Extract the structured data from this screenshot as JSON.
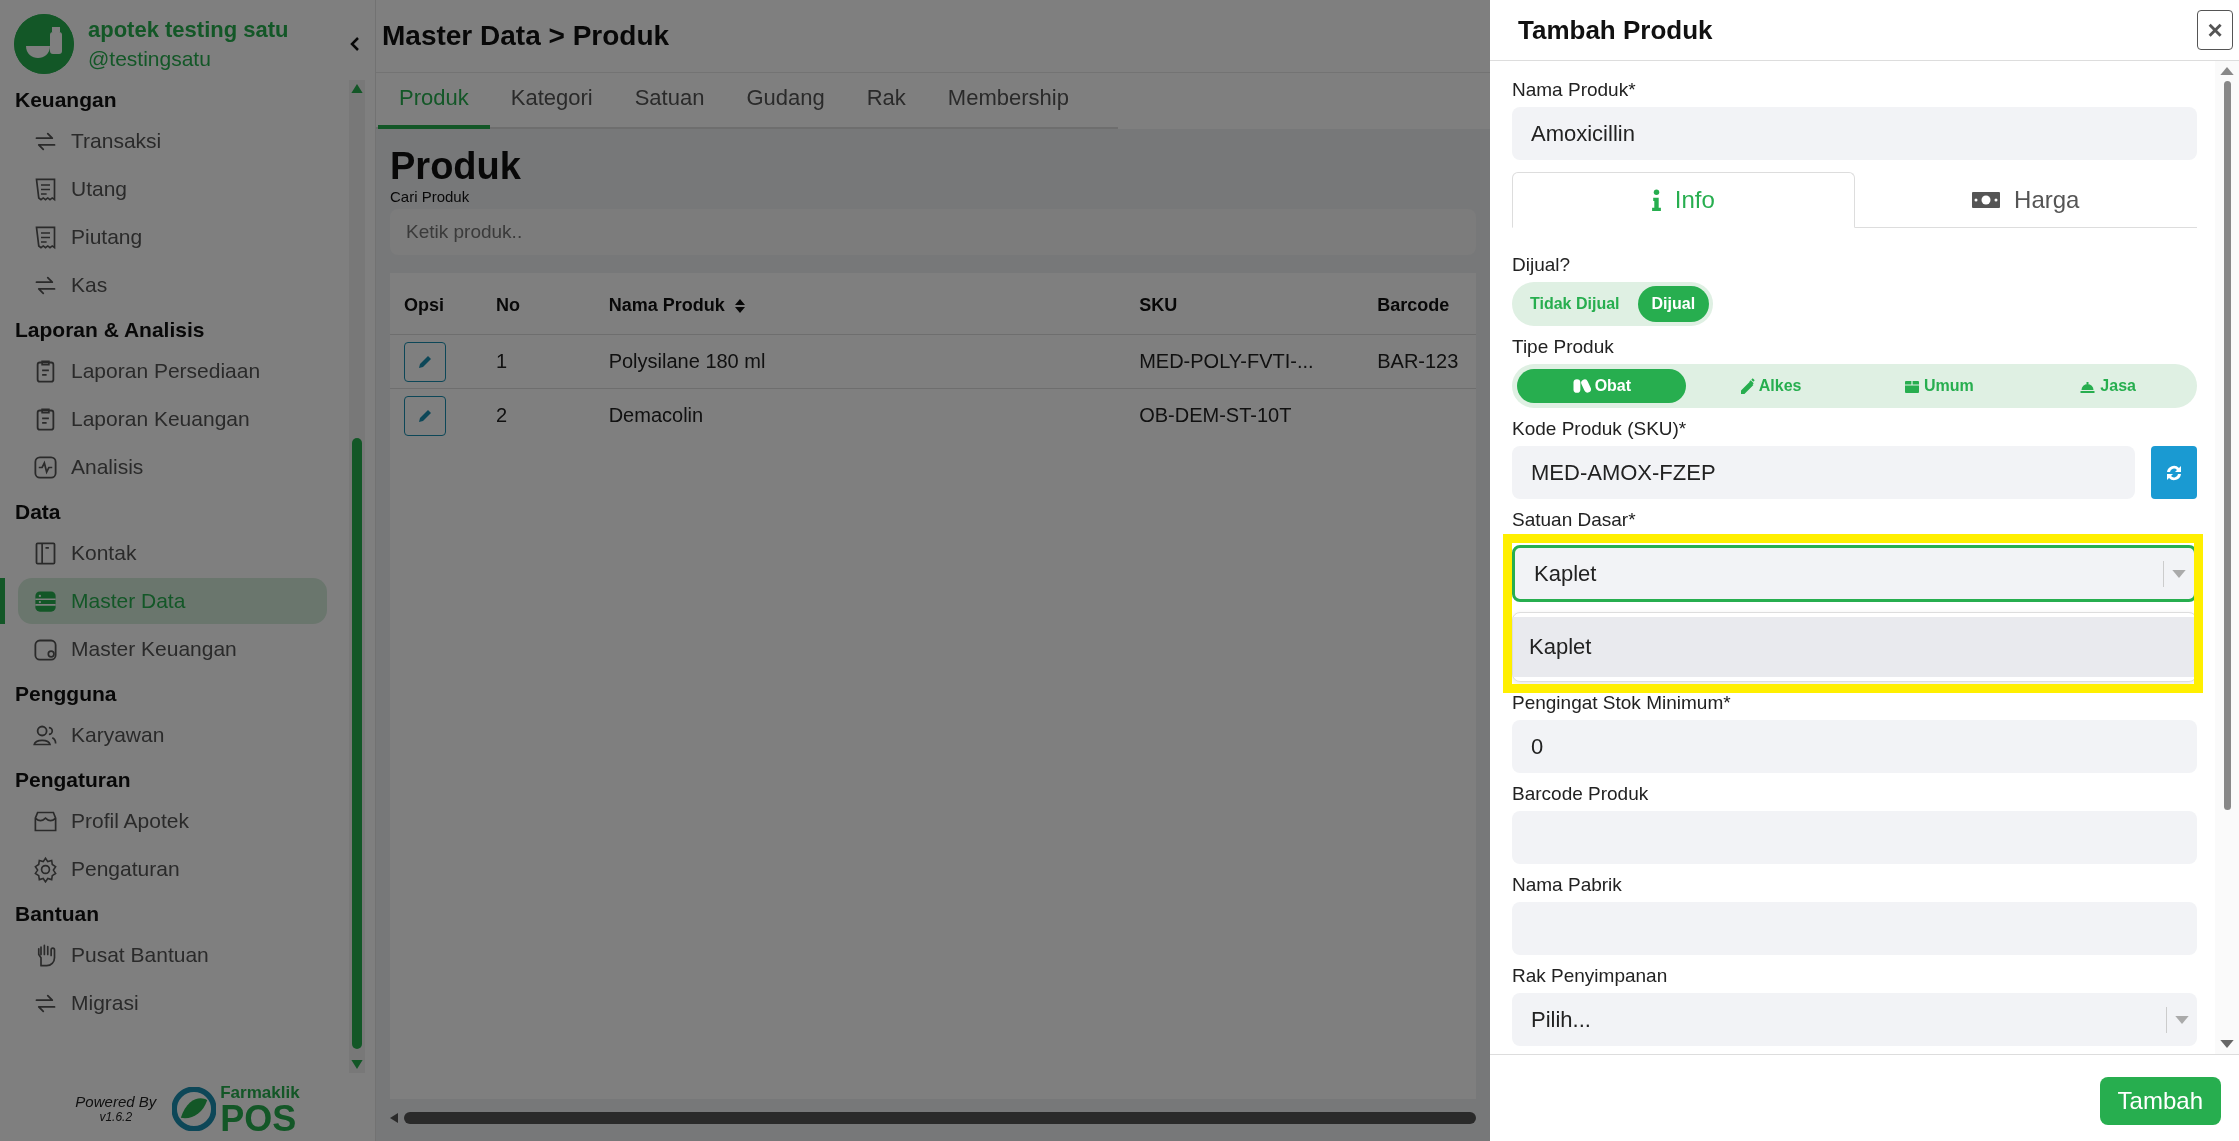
{
  "brand": {
    "name": "apotek testing satu",
    "handle": "@testingsatu"
  },
  "sidebar": {
    "sections": [
      {
        "title": "Keuangan",
        "items": [
          {
            "label": "Transaksi",
            "selected": false
          },
          {
            "label": "Utang",
            "selected": false
          },
          {
            "label": "Piutang",
            "selected": false
          },
          {
            "label": "Kas",
            "selected": false
          }
        ]
      },
      {
        "title": "Laporan & Analisis",
        "items": [
          {
            "label": "Laporan Persediaan",
            "selected": false
          },
          {
            "label": "Laporan Keuangan",
            "selected": false
          },
          {
            "label": "Analisis",
            "selected": false
          }
        ]
      },
      {
        "title": "Data",
        "items": [
          {
            "label": "Kontak",
            "selected": false
          },
          {
            "label": "Master Data",
            "selected": true
          },
          {
            "label": "Master Keuangan",
            "selected": false
          }
        ]
      },
      {
        "title": "Pengguna",
        "items": [
          {
            "label": "Karyawan",
            "selected": false
          }
        ]
      },
      {
        "title": "Pengaturan",
        "items": [
          {
            "label": "Profil Apotek",
            "selected": false
          },
          {
            "label": "Pengaturan",
            "selected": false
          }
        ]
      },
      {
        "title": "Bantuan",
        "items": [
          {
            "label": "Pusat Bantuan",
            "selected": false
          },
          {
            "label": "Migrasi",
            "selected": false
          }
        ]
      }
    ],
    "powered_by": "Powered By",
    "version": "v1.6.2",
    "logo": {
      "top": "Farmaklik",
      "bottom": "POS"
    }
  },
  "breadcrumb": "Master Data > Produk",
  "tabs": [
    {
      "label": "Produk",
      "selected": true
    },
    {
      "label": "Kategori",
      "selected": false
    },
    {
      "label": "Satuan",
      "selected": false
    },
    {
      "label": "Gudang",
      "selected": false
    },
    {
      "label": "Rak",
      "selected": false
    },
    {
      "label": "Membership",
      "selected": false
    }
  ],
  "page_title": "Produk",
  "search": {
    "label": "Cari Produk",
    "placeholder": "Ketik produk.."
  },
  "table": {
    "columns": [
      "Opsi",
      "No",
      "Nama Produk",
      "SKU",
      "Barcode"
    ],
    "rows": [
      {
        "no": "1",
        "name": "Polysilane 180 ml",
        "sku": "MED-POLY-FVTI-...",
        "barcode": "BAR-123"
      },
      {
        "no": "2",
        "name": "Demacolin",
        "sku": "OB-DEM-ST-10T"
      }
    ]
  },
  "modal": {
    "title": "Tambah Produk",
    "close": "×",
    "name": {
      "label": "Nama Produk*",
      "value": "Amoxicillin"
    },
    "tabs": [
      {
        "label": "Info",
        "selected": true
      },
      {
        "label": "Harga",
        "selected": false
      }
    ],
    "sold": {
      "label": "Dijual?",
      "options": [
        {
          "label": "Tidak Dijual",
          "selected": false
        },
        {
          "label": "Dijual",
          "selected": true
        }
      ]
    },
    "type": {
      "label": "Tipe Produk",
      "options": [
        {
          "label": "Obat",
          "selected": true
        },
        {
          "label": "Alkes",
          "selected": false
        },
        {
          "label": "Umum",
          "selected": false
        },
        {
          "label": "Jasa",
          "selected": false
        }
      ]
    },
    "sku": {
      "label": "Kode Produk (SKU)*",
      "value": "MED-AMOX-FZEP"
    },
    "unit": {
      "label": "Satuan Dasar*",
      "value": "Kaplet",
      "expanded": true,
      "options": [
        "Kaplet"
      ]
    },
    "fields": [
      {
        "kind": "input",
        "label": "Pengingat Stok Minimum*",
        "value": "0"
      },
      {
        "kind": "input",
        "label": "Barcode Produk"
      },
      {
        "kind": "input",
        "label": "Nama Pabrik"
      },
      {
        "kind": "select",
        "label": "Rak Penyimpanan",
        "value": "Pilih..."
      }
    ],
    "submit": "Tambah"
  }
}
